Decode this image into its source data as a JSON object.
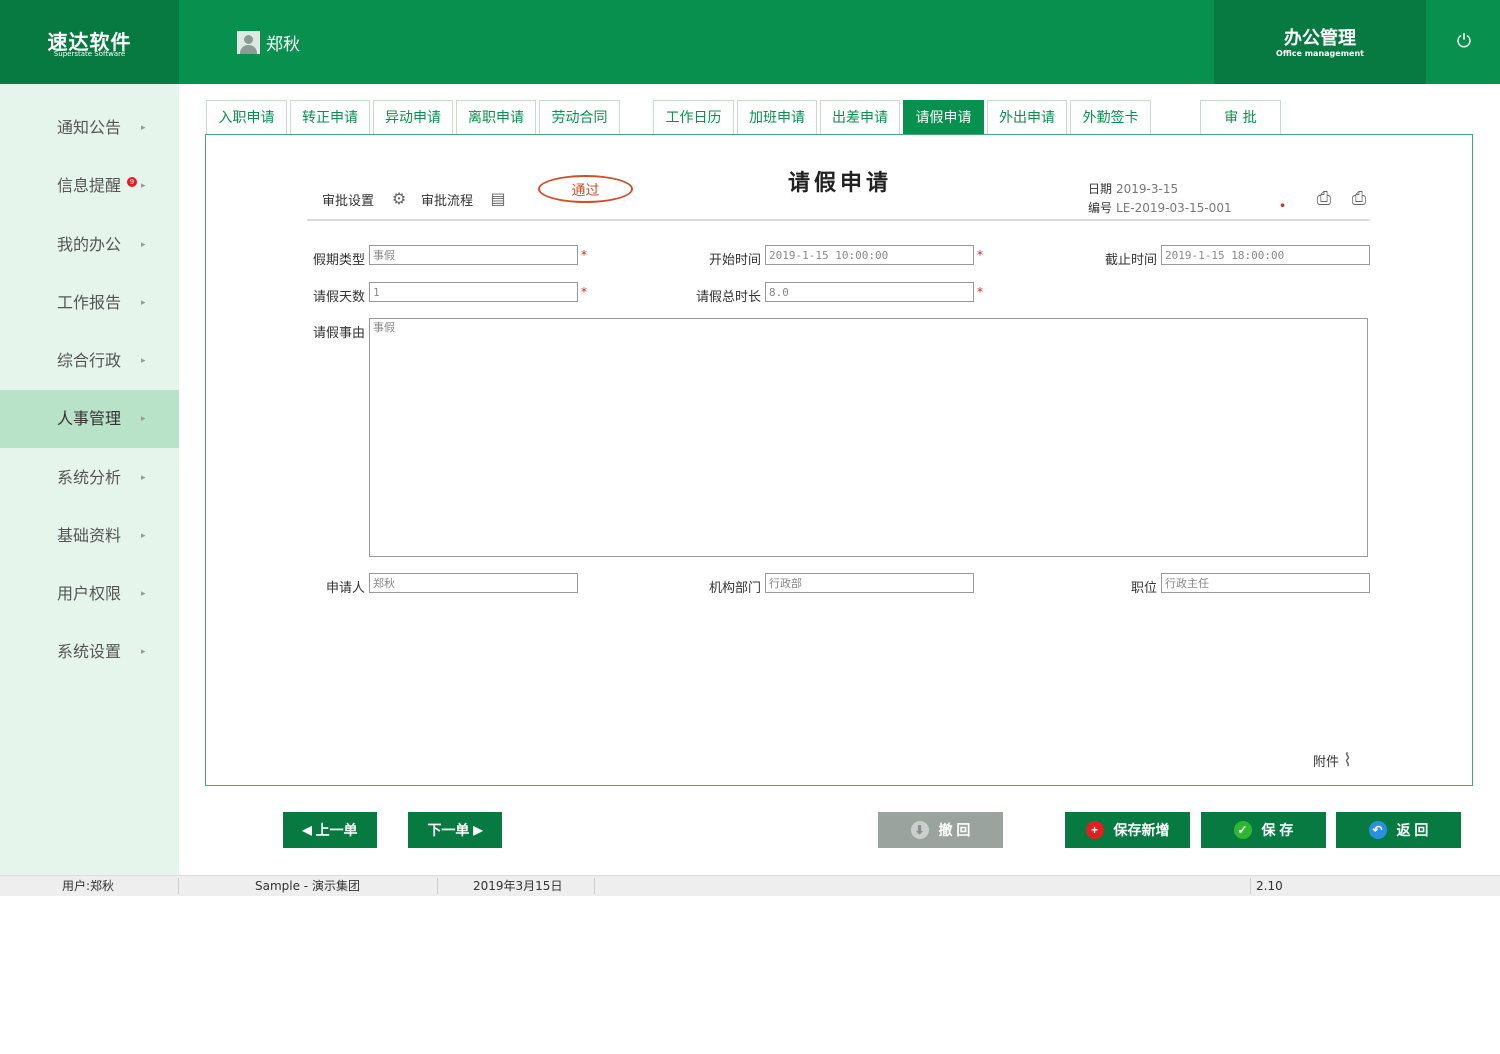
{
  "header": {
    "brand_name": "速达软件",
    "brand_sub": "Superstate Software",
    "user_name": "郑秋",
    "module_title": "办公管理",
    "module_sub": "Office management"
  },
  "sidebar": {
    "items": [
      {
        "label": "通知公告"
      },
      {
        "label": "信息提醒",
        "badge": "9"
      },
      {
        "label": "我的办公"
      },
      {
        "label": "工作报告"
      },
      {
        "label": "综合行政"
      },
      {
        "label": "人事管理",
        "active": true
      },
      {
        "label": "系统分析"
      },
      {
        "label": "基础资料"
      },
      {
        "label": "用户权限"
      },
      {
        "label": "系统设置"
      }
    ]
  },
  "tabs": [
    {
      "label": "入职申请"
    },
    {
      "label": "转正申请"
    },
    {
      "label": "异动申请"
    },
    {
      "label": "离职申请"
    },
    {
      "label": "劳动合同"
    },
    {
      "label": "工作日历"
    },
    {
      "label": "加班申请"
    },
    {
      "label": "出差申请"
    },
    {
      "label": "请假申请",
      "active": true
    },
    {
      "label": "外出申请"
    },
    {
      "label": "外勤签卡"
    },
    {
      "label": "审 批"
    }
  ],
  "form": {
    "title": "请假申请",
    "approval_settings": "审批设置",
    "approval_flow": "审批流程",
    "stamp": "通过",
    "date_label": "日期",
    "date_value": "2019-3-15",
    "number_label": "编号",
    "number_value": "LE-2019-03-15-001",
    "fields": {
      "leave_type": {
        "label": "假期类型",
        "value": "事假"
      },
      "start_time": {
        "label": "开始时间",
        "value": "2019-1-15 10:00:00"
      },
      "end_time": {
        "label": "截止时间",
        "value": "2019-1-15 18:00:00"
      },
      "days": {
        "label": "请假天数",
        "value": "1"
      },
      "total_hours": {
        "label": "请假总时长",
        "value": "8.0"
      },
      "reason": {
        "label": "请假事由",
        "value": "事假"
      },
      "applicant": {
        "label": "申请人",
        "value": "郑秋"
      },
      "department": {
        "label": "机构部门",
        "value": "行政部"
      },
      "position": {
        "label": "职位",
        "value": "行政主任"
      }
    },
    "attachment": "附件"
  },
  "buttons": {
    "prev": "上一单",
    "next": "下一单",
    "withdraw": "撤 回",
    "save_new": "保存新增",
    "save": "保 存",
    "back": "返 回"
  },
  "status_bar": {
    "user": "用户:郑秋",
    "company": "Sample - 演示集团",
    "date": "2019年3月15日",
    "version": "2.10"
  },
  "colors": {
    "primary": "#08904f",
    "dark": "#067a40",
    "sidebar_bg": "#e6f5ec",
    "sidebar_active": "#b8e3c9",
    "stamp": "#d0502a",
    "required": "#e02020"
  }
}
